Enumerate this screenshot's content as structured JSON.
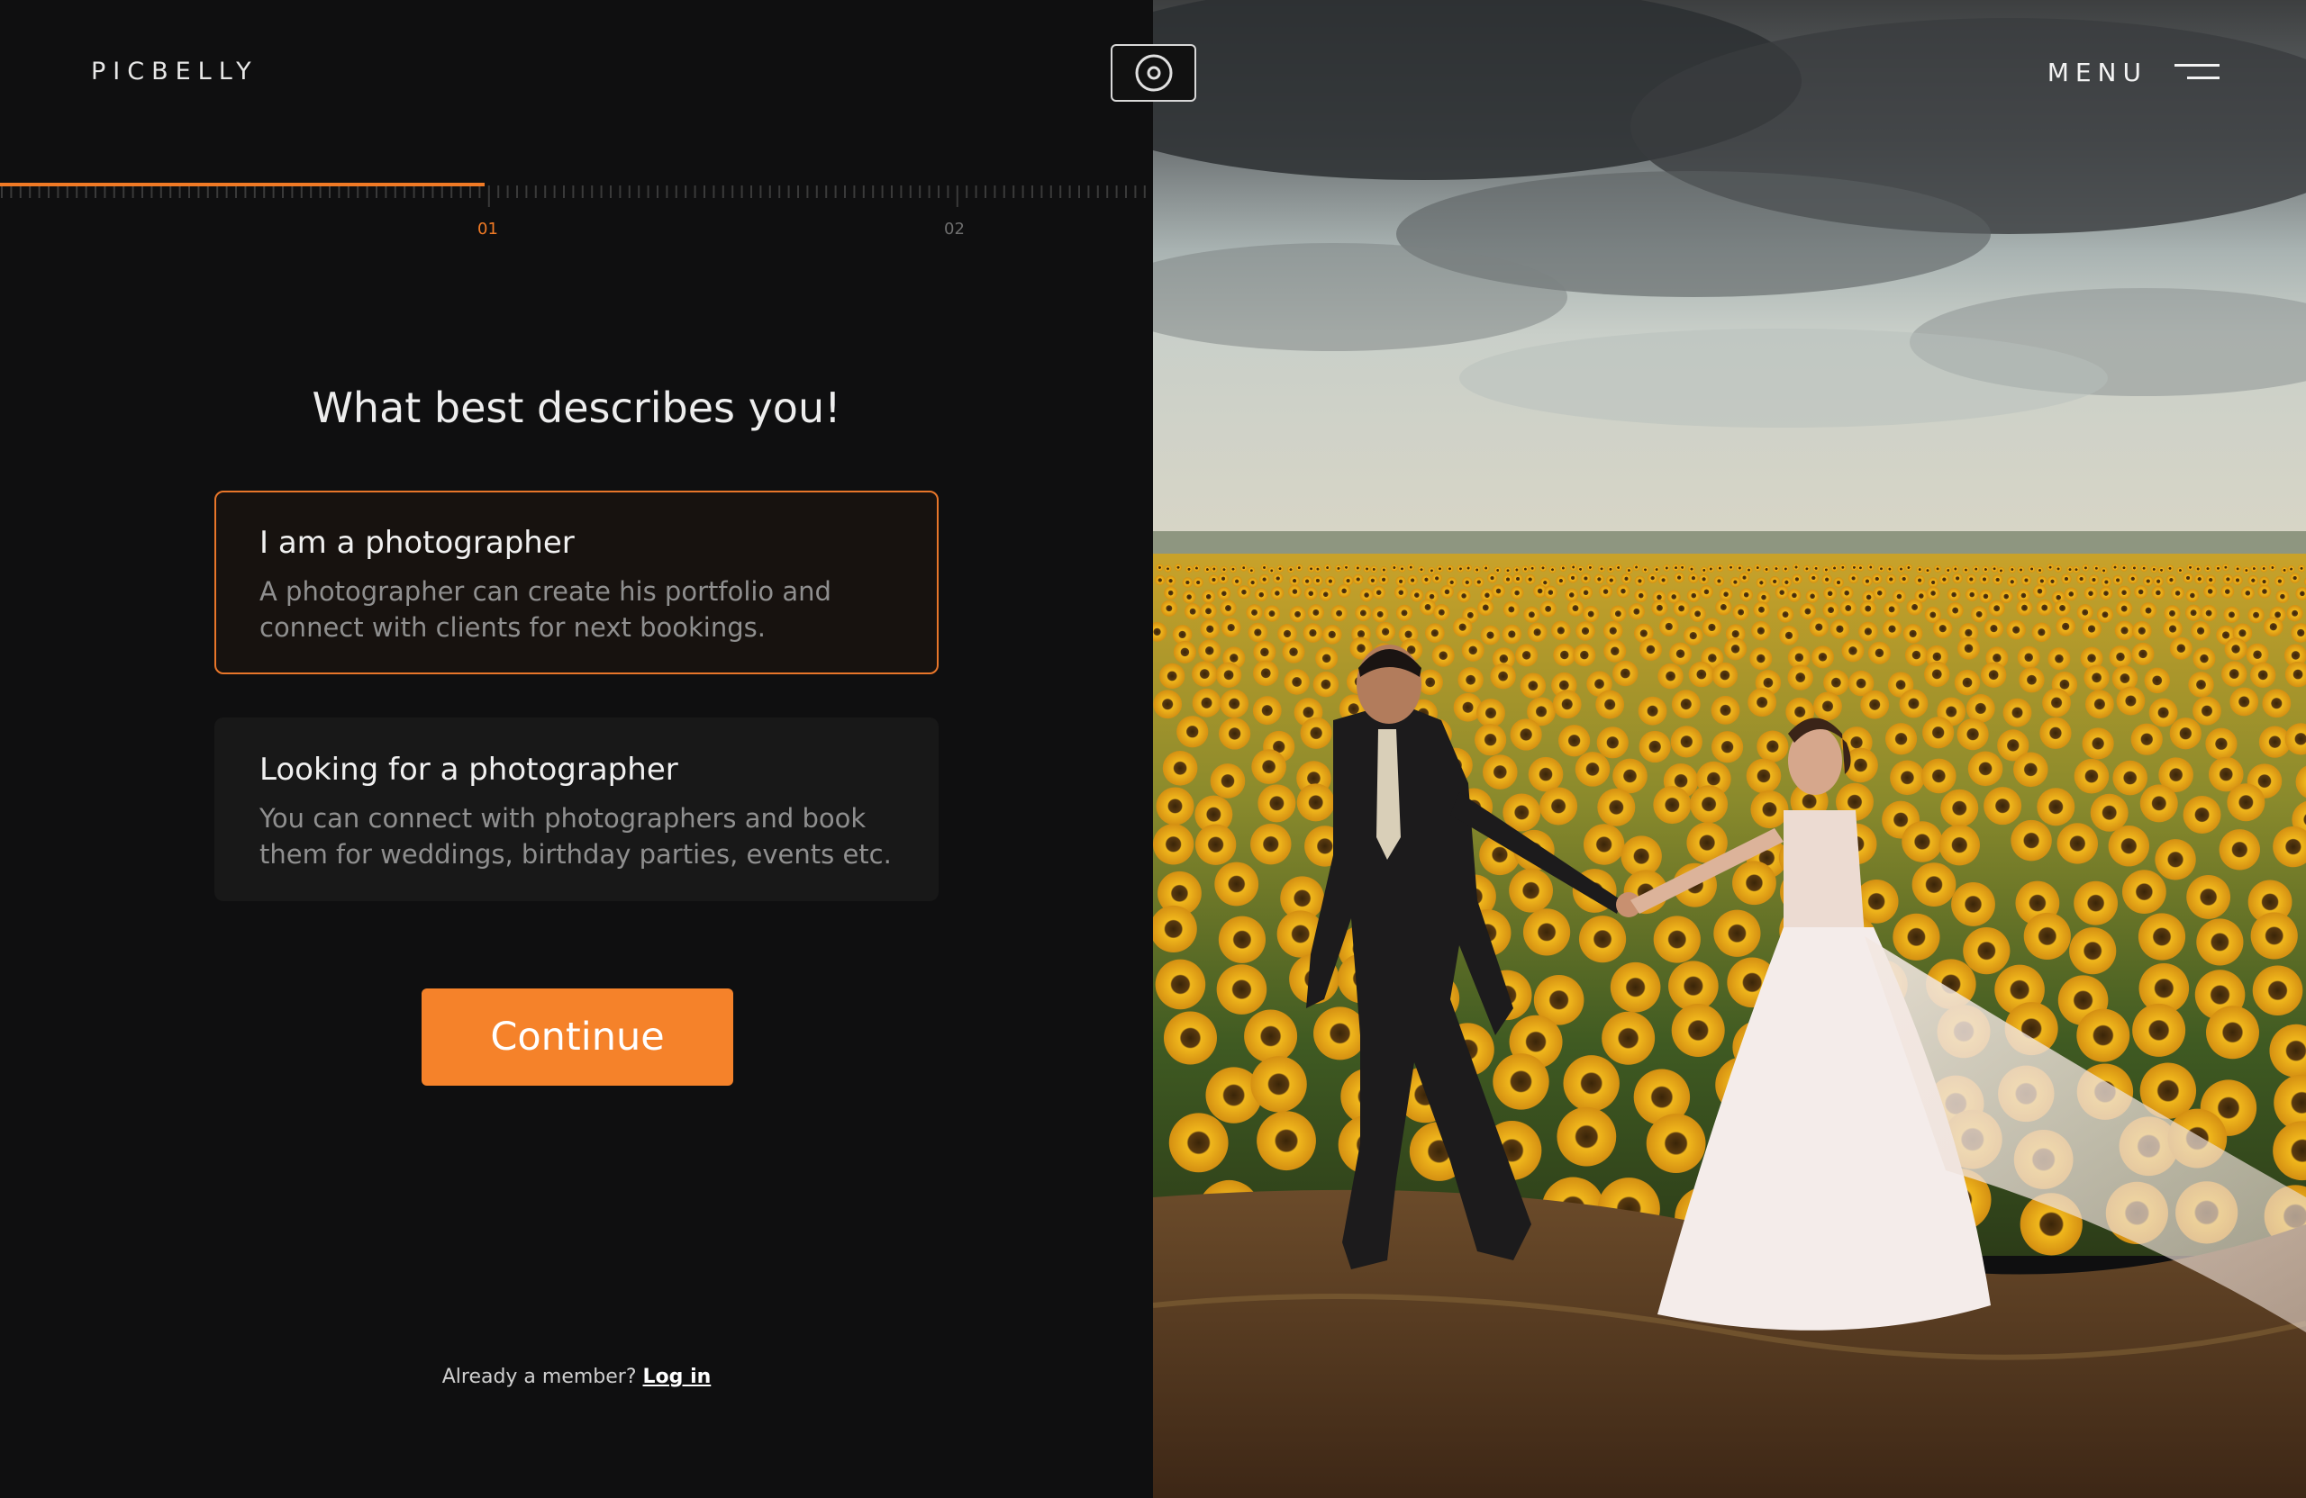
{
  "header": {
    "logo": "PICBELLY",
    "menu_label": "MENU"
  },
  "progress": {
    "current_step": 1,
    "total_steps": 2,
    "fraction": 0.42,
    "steps": [
      "01",
      "02"
    ]
  },
  "main": {
    "heading": "What best describes you!",
    "options": [
      {
        "title": "I am a photographer",
        "description": "A photographer can create his portfolio and connect with clients for next bookings.",
        "selected": true
      },
      {
        "title": "Looking for a photographer",
        "description": "You can connect with photographers and book them for weddings, birthday parties, events etc.",
        "selected": false
      }
    ],
    "continue_label": "Continue"
  },
  "footer": {
    "member_text": "Already a member?",
    "login_label": "Log in"
  },
  "colors": {
    "accent": "#f5822a",
    "background": "#0f0f10",
    "card": "#181818"
  }
}
